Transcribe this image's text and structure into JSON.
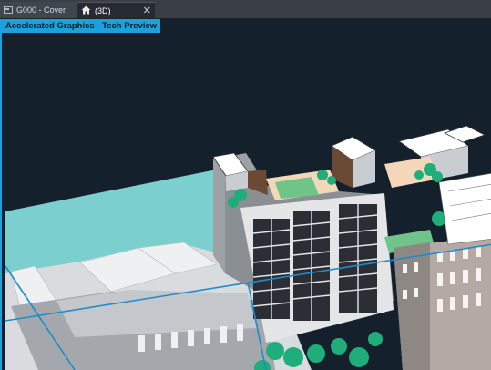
{
  "tabs": [
    {
      "label": "G000 - Cover",
      "icon": "sheet-icon",
      "active": false
    },
    {
      "label": "(3D)",
      "icon": "home-icon",
      "active": true
    }
  ],
  "tab_close_glyph": "✕",
  "viewport": {
    "badge": "Accelerated Graphics - Tech Preview",
    "background": "#15202d",
    "accent": "#1ea0dc"
  }
}
